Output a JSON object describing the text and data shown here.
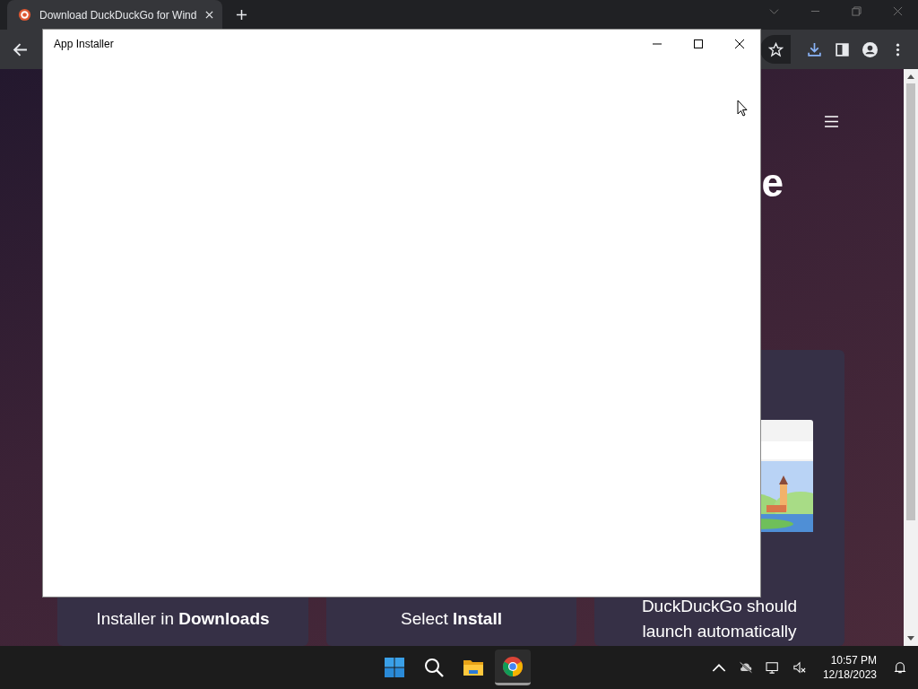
{
  "browser": {
    "tabs": [
      {
        "title": "Download DuckDuckGo for Wind",
        "selected": true
      }
    ]
  },
  "page": {
    "heading_fragment": "e",
    "steps": [
      {
        "text": "Installer in **Downloads**"
      },
      {
        "text": "Select **Install**"
      },
      {
        "text": "DuckDuckGo should launch automatically",
        "illustration": true
      }
    ]
  },
  "dialog": {
    "title": "App Installer"
  },
  "taskbar": {
    "apps": [
      {
        "kind": "start",
        "selected": false
      },
      {
        "kind": "search",
        "selected": false
      },
      {
        "kind": "files",
        "selected": false
      },
      {
        "kind": "chrome",
        "selected": true
      }
    ],
    "time": "10:57 PM",
    "date": "12/18/2023"
  }
}
